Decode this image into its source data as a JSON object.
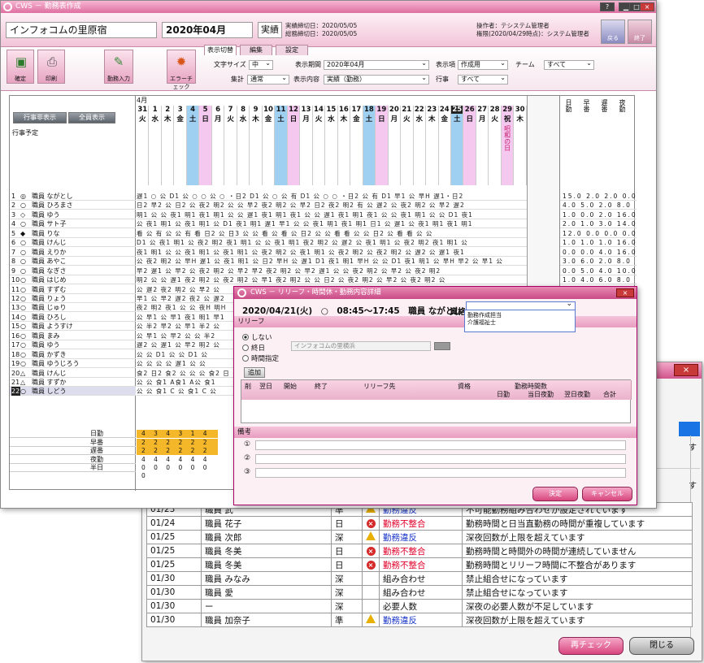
{
  "main_window": {
    "title": "CWS － 勤務表作成",
    "facility": "インフォコムの里原宿",
    "month": "2020年04月",
    "mode": "実績",
    "dates": [
      "実績締切日：2020/05/05",
      "総務締切日：2020/05/05"
    ],
    "operator": [
      "操作者：テシステム管理者",
      "権限(2020/04/29時点)：システム管理者"
    ],
    "back_label": "戻る",
    "exit_label": "終了"
  },
  "toolbar": {
    "buttons": [
      "確定",
      "印刷",
      "勤務入力",
      "エラーチェック"
    ],
    "tabs": [
      "表示切替",
      "編集",
      "設定"
    ],
    "font_size_label": "文字サイズ",
    "font_size": "中",
    "period_label": "表示期間",
    "period": "2020年04月",
    "display_items_label": "表示項",
    "display_items": "作成用",
    "team_label": "チーム",
    "team": "すべて",
    "total_label": "集計",
    "total": "通常",
    "content_label": "表示内容",
    "content": "実績（勤務）",
    "event_label": "行事",
    "event": "すべて"
  },
  "grid": {
    "buttons": [
      "行事非表示",
      "全員表示"
    ],
    "event_label": "行事予定",
    "month_label": "4月",
    "days": [
      "31",
      "1",
      "2",
      "3",
      "4",
      "5",
      "6",
      "7",
      "8",
      "9",
      "10",
      "11",
      "12",
      "13",
      "14",
      "15",
      "16",
      "17",
      "18",
      "19",
      "20",
      "21",
      "22",
      "23",
      "24",
      "25",
      "26",
      "27",
      "28",
      "29",
      "30"
    ],
    "weekdays": [
      "火",
      "水",
      "木",
      "金",
      "土",
      "日",
      "月",
      "火",
      "水",
      "木",
      "金",
      "土",
      "日",
      "月",
      "火",
      "水",
      "木",
      "金",
      "土",
      "日",
      "月",
      "火",
      "水",
      "木",
      "金",
      "土",
      "日",
      "月",
      "火",
      "祝",
      "木"
    ],
    "holiday_note": "昭和の日",
    "stat_headers": [
      "日勤",
      "早番",
      "遅番",
      "夜勤"
    ],
    "staff": [
      {
        "no": "1",
        "mark": "◎",
        "name": "職員 ながとし",
        "cells": "遅1 ○ 公 D1 公 ○ ○ 公 ○ ・日2 D1 公 ○ 公 有 D1 公 ○ ○ ・日2 公 有 D1 早1 公 早H 遅1・日2",
        "stats": "15.0 2.0 2.0 0.0"
      },
      {
        "no": "2",
        "mark": "○",
        "name": "職員 ひろまさ",
        "cells": "日2 早2 公 日2 公 夜2 明2 公 公 早2 夜2 明2 公 早2 日2 夜2 明2 有 公 遅2 公 夜2 明2 公 早2 遅2",
        "stats": "4.0 5.0 2.0 8.0"
      },
      {
        "no": "3",
        "mark": "◇",
        "name": "職員 ゆう",
        "cells": "明1 公 公 夜1 明1 夜1 明1 公 公 遅1 夜1 明1 夜1 公 公 遅1 夜1 明1 夜1 公 公 夜1 明1 公 公 D1 夜1",
        "stats": "1.0 0.0 2.0 16.0"
      },
      {
        "no": "4",
        "mark": "○",
        "name": "職員 サト子",
        "cells": "公 夜1 明1 公 夜1 明1 公 D1 夜1 明1 遅1 早1 公 公 夜1 明1 夜1 明1 日1 公 遅1 公 夜1 明1 夜1 明1",
        "stats": "2.0 1.0 3.0 14.0"
      },
      {
        "no": "5",
        "mark": "◆",
        "name": "職員 りな",
        "cells": "看 公 有 公 公 有 看 日2 公 日3 公 公 看 公 看 公 日2 公 公 看 看 公 公 日2 公 看 看 公 公",
        "stats": "12.0 0.0 0.0 0.0"
      },
      {
        "no": "6",
        "mark": "○",
        "name": "職員 けんじ",
        "cells": "D1 公 夜1 明1 公 夜2 明2 夜1 明1 公 公 夜1 明1 夜2 明2 公 遅2 公 夜1 明1 公 夜2 明2 夜1 明1 公",
        "stats": "1.0 1.0 1.0 16.0"
      },
      {
        "no": "7",
        "mark": "○",
        "name": "職員 えりか",
        "cells": "夜1 明1 公 公 夜1 明1 公 夜1 明1 公 夜2 明2 公 夜1 明1 公 夜2 明2 公 夜2 明2 公 遅2 公 遅1 夜1",
        "stats": "0.0 0.0 4.0 16.0"
      },
      {
        "no": "8",
        "mark": "○",
        "name": "職員 あやこ",
        "cells": "公 夜2 明2 公 早H 遅1 公 夜1 明1 公 日2 早H 公 遅1 D1 夜1 明1 早H 公 公 D1 夜1 明1 公 早H 早2 公 早1 公",
        "stats": "3.0 6.0 2.0 8.0"
      },
      {
        "no": "9",
        "mark": "○",
        "name": "職員 なぎさ",
        "cells": "早2 遅1 公 早2 公 夜2 明2 公 早2 早2 夜2 明2 公 早2 遅1 公 公 夜2 明2 公 早2 公 夜2 明2",
        "stats": "0.0 5.0 4.0 10.0"
      },
      {
        "no": "10",
        "mark": "○",
        "name": "職員 はじめ",
        "cells": "明2 公 公 遅1 夜2 明2 公 夜2 明2 公 早1 夜2 明2 公 公 日2 公 夜2 明2 公 早2 公 夜2 明2 公",
        "stats": "1.0 4.0 6.0 8.0"
      },
      {
        "no": "11",
        "mark": "○",
        "name": "職員 すずむ",
        "cells": "公 遅2 夜2 明2 公 早2 公",
        "stats": ""
      },
      {
        "no": "12",
        "mark": "○",
        "name": "職員 りょう",
        "cells": "早1 公 早2 遅2 夜2 公 遅2",
        "stats": ""
      },
      {
        "no": "13",
        "mark": "○",
        "name": "職員 じゅり",
        "cells": "夜2 明2 夜1 公 公 夜H 明H",
        "stats": ""
      },
      {
        "no": "14",
        "mark": "○",
        "name": "職員 ひろし",
        "cells": "公 早1 公 早1 夜1 明1 早1",
        "stats": ""
      },
      {
        "no": "15",
        "mark": "○",
        "name": "職員 ようすけ",
        "cells": "公 半2 早2 公 早1 半2 公",
        "stats": ""
      },
      {
        "no": "16",
        "mark": "○",
        "name": "職員 まみ",
        "cells": "公 早1 公 早2 公 公 半2",
        "stats": ""
      },
      {
        "no": "17",
        "mark": "○",
        "name": "職員 ゆう",
        "cells": "遅2 公 遅1 公 早2 明2 公",
        "stats": ""
      },
      {
        "no": "18",
        "mark": "○",
        "name": "職員 かずき",
        "cells": "公 公 D1 公 公 D1 公",
        "stats": ""
      },
      {
        "no": "19",
        "mark": "○",
        "name": "職員 ゆうじろう",
        "cells": "公 公 公 公 遅1 公 公",
        "stats": ""
      },
      {
        "no": "20",
        "mark": "△",
        "name": "職員 けんじ",
        "cells": "食2 日2 食2 公 公 公 食2 日",
        "stats": ""
      },
      {
        "no": "21",
        "mark": "△",
        "name": "職員 すずか",
        "cells": "公 公 食1 A食1 A公 食1",
        "stats": ""
      },
      {
        "no": "22",
        "mark": "○",
        "name": "職員 しどう",
        "cells": "公 公 食1 C 公 食1 C 公",
        "stats": ""
      }
    ],
    "summary_labels": [
      "日勤",
      "早番",
      "遅番",
      "夜勤",
      "半日"
    ],
    "summary_values": [
      "4 3 4 3 1 4 4",
      "2 2 2 2 2 2 2",
      "2 2 2 2 2 2 2",
      "4 4 4 4 4 4 4",
      "0 0 0 0 0 0 0"
    ]
  },
  "dialog": {
    "title": "CWS － リリーフ・時間休・勤務内容詳細",
    "info": "2020/04/21(火)　○　08:45～17:45　職員 ながとし",
    "qual_label": "資格",
    "qual_options": [
      "勤務作成担当",
      "介護福祉士"
    ],
    "relief_section": "リリーフ",
    "radio": [
      "しない",
      "終日",
      "時間指定"
    ],
    "relief_place": "インフォコムの里横浜",
    "add_label": "追加",
    "table_headers": [
      "削",
      "翌日",
      "開始",
      "終了",
      "リリーフ先",
      "資格",
      "勤務時間数"
    ],
    "table_subheaders": [
      "日勤",
      "当日夜勤",
      "翌日夜勤",
      "合計"
    ],
    "note_section": "備考",
    "note_marks": [
      "①",
      "②",
      "③"
    ],
    "ok_label": "決定",
    "cancel_label": "キャンセル"
  },
  "errors": {
    "rows": [
      {
        "date": "01/23",
        "name": "職員 武",
        "shift": "準",
        "level": "warn",
        "type": "勤務違反",
        "msg": "不可能勤務組み合わせが設定されています"
      },
      {
        "date": "01/24",
        "name": "職員 花子",
        "shift": "日",
        "level": "err",
        "type": "勤務不整合",
        "msg": "勤務時間と日当直勤務の時間が重複しています"
      },
      {
        "date": "01/25",
        "name": "職員 次郎",
        "shift": "深",
        "level": "warn",
        "type": "勤務違反",
        "msg": "深夜回数が上限を超えています"
      },
      {
        "date": "01/25",
        "name": "職員 冬美",
        "shift": "日",
        "level": "err",
        "type": "勤務不整合",
        "msg": "勤務時間と時間外の時間が連続していません"
      },
      {
        "date": "01/25",
        "name": "職員 冬美",
        "shift": "日",
        "level": "err",
        "type": "勤務不整合",
        "msg": "勤務時間とリリーフ時間に不整合があります"
      },
      {
        "date": "01/30",
        "name": "職員 みなみ",
        "shift": "深",
        "level": "none",
        "type": "組み合わせ",
        "msg": "禁止組合せになっています"
      },
      {
        "date": "01/30",
        "name": "職員 愛",
        "shift": "深",
        "level": "none",
        "type": "組み合わせ",
        "msg": "禁止組合せになっています"
      },
      {
        "date": "01/30",
        "name": "ー",
        "shift": "深",
        "level": "none",
        "type": "必要人数",
        "msg": "深夜の必要人数が不足しています"
      },
      {
        "date": "01/30",
        "name": "職員 加奈子",
        "shift": "準",
        "level": "warn",
        "type": "勤務違反",
        "msg": "深夜回数が上限を超えています"
      }
    ],
    "visible_right_text": [
      "す",
      "す"
    ],
    "recheck_label": "再チェック",
    "close_label": "閉じる",
    "close_icon": "×"
  },
  "colors": {
    "brand_pink": "#df6fa1",
    "saturday": "#9fd0f2",
    "sunday": "#f4c8ef",
    "error_red": "#e0002a",
    "link_blue": "#1a37c8"
  }
}
